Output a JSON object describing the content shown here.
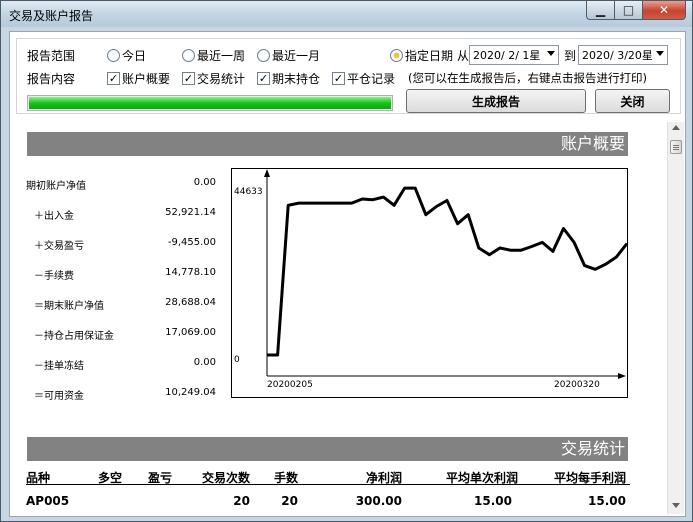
{
  "window": {
    "title": "交易及账户报告"
  },
  "controls": {
    "range_label": "报告范围",
    "content_label": "报告内容",
    "ranges": [
      {
        "label": "今日",
        "selected": false
      },
      {
        "label": "最近一周",
        "selected": false
      },
      {
        "label": "最近一月",
        "selected": false
      },
      {
        "label": "指定日期",
        "selected": true
      }
    ],
    "from_label": "从",
    "to_label": "到",
    "from_date": "2020/ 2/ 1星",
    "to_date": "2020/ 3/20星",
    "contents": [
      {
        "label": "账户概要",
        "checked": true
      },
      {
        "label": "交易统计",
        "checked": true
      },
      {
        "label": "期末持仓",
        "checked": true
      },
      {
        "label": "平仓记录",
        "checked": true
      }
    ],
    "hint": "(您可以在生成报告后，右键点击报告进行打印)",
    "progress": 1.0,
    "generate_label": "生成报告",
    "close_label": "关闭"
  },
  "summary": {
    "section_title": "账户概要",
    "rows": [
      {
        "label": "期初账户净值",
        "value": "0.00"
      },
      {
        "label": "＋出入金",
        "value": "52,921.14"
      },
      {
        "label": "＋交易盈亏",
        "value": "-9,455.00"
      },
      {
        "label": "－手续费",
        "value": "14,778.10"
      },
      {
        "label": "＝期末账户净值",
        "value": "28,688.04"
      },
      {
        "label": "－持仓占用保证金",
        "value": "17,069.00"
      },
      {
        "label": "－挂单冻结",
        "value": "0.00"
      },
      {
        "label": "＝可用资金",
        "value": "10,249.04"
      }
    ]
  },
  "chart_data": {
    "type": "line",
    "ytick_top": "44633",
    "ytick_bottom": "0",
    "ylim": [
      0,
      44633
    ],
    "x_start_label": "20200205",
    "x_end_label": "20200320",
    "values": [
      0,
      0,
      40000,
      40600,
      40600,
      40600,
      40600,
      40600,
      40600,
      41700,
      41500,
      42200,
      40000,
      44600,
      44600,
      37500,
      39700,
      41300,
      35100,
      37500,
      28600,
      26800,
      28600,
      28000,
      28000,
      29000,
      30100,
      27700,
      33800,
      30100,
      23900,
      22900,
      24300,
      26200,
      29800
    ]
  },
  "stats": {
    "section_title": "交易统计",
    "columns": [
      "品种",
      "多空",
      "盈亏",
      "交易次数",
      "手数",
      "净利润",
      "平均单次利润",
      "平均每手利润"
    ],
    "rows": [
      [
        "AP005",
        "",
        "",
        "20",
        "20",
        "300.00",
        "15.00",
        "15.00"
      ]
    ]
  }
}
